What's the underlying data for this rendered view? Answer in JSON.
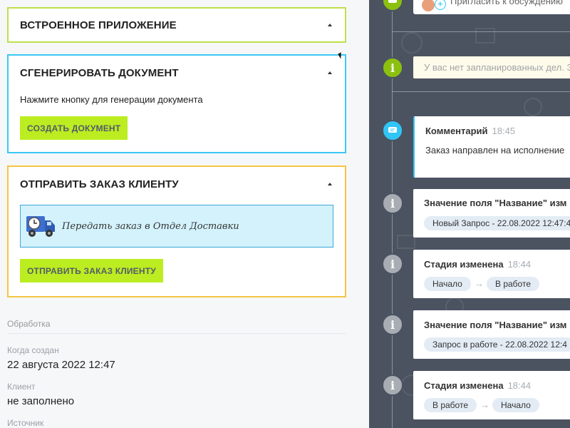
{
  "cards": {
    "embedded_app": {
      "title": "ВСТРОЕННОЕ ПРИЛОЖЕНИЕ"
    },
    "generate_doc": {
      "title": "СГЕНЕРИРОВАТЬ ДОКУМЕНТ",
      "hint": "Нажмите кнопку для генерации документа",
      "button": "СОЗДАТЬ ДОКУМЕНТ"
    },
    "send_order": {
      "title": "ОТПРАВИТЬ ЗАКАЗ КЛИЕНТУ",
      "delivery_text": "Передать заказ в Отдел Доставки",
      "button": "ОТПРАВИТЬ ЗАКАЗ КЛИЕНТУ"
    }
  },
  "details": {
    "section": "Обработка",
    "fields": [
      {
        "label": "Когда создан",
        "value": "22 августа 2022 12:47"
      },
      {
        "label": "Клиент",
        "value": "не заполнено"
      },
      {
        "label": "Источник",
        "value": ""
      }
    ]
  },
  "timeline": {
    "invite_text": "Пригласить к обсуждению",
    "no_tasks": "У вас нет запланированных дел. З",
    "events": [
      {
        "title": "Комментарий",
        "time": "18:45",
        "body": "Заказ направлен на исполнение"
      },
      {
        "title": "Значение поля \"Название\" изм",
        "pill": "Новый Запрос - 22.08.2022 12:47:4"
      },
      {
        "title": "Стадия изменена",
        "time": "18:44",
        "from": "Начало",
        "to": "В работе"
      },
      {
        "title": "Значение поля \"Название\" изм",
        "pill": "Запрос в работе - 22.08.2022 12:4"
      },
      {
        "title": "Стадия изменена",
        "time": "18:44",
        "from": "В работе",
        "to": "Начало"
      }
    ]
  },
  "colors": {
    "green_border": "#bde14b",
    "blue_border": "#3bc8f5",
    "yellow_border": "#f5c542",
    "button_green": "#bbed21",
    "timeline_bg": "#4b5361"
  }
}
